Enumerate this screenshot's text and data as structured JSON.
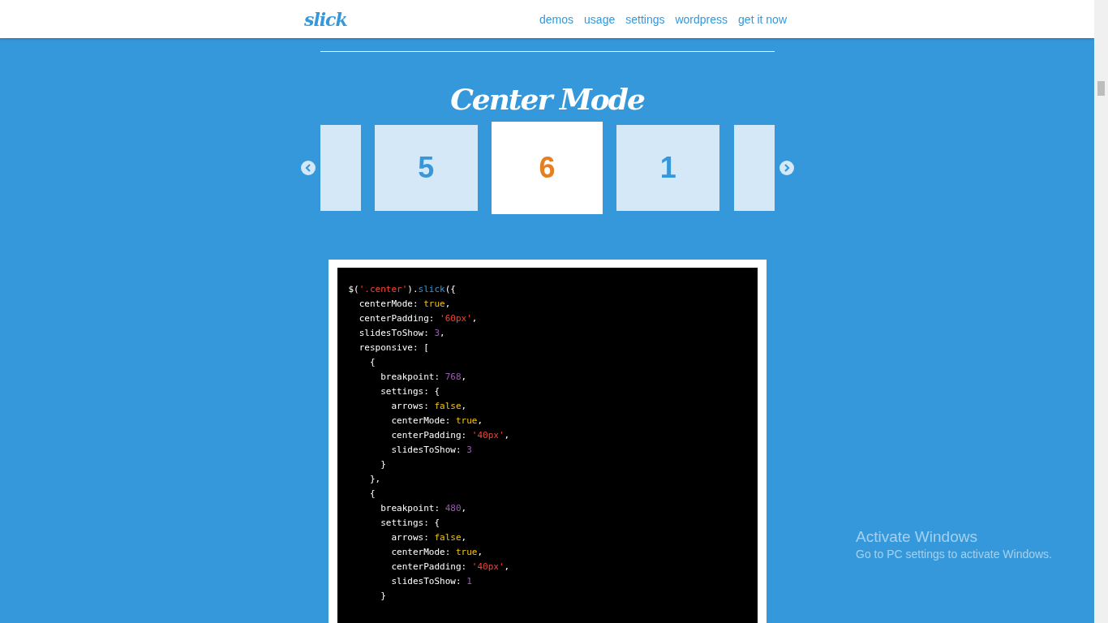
{
  "header": {
    "logo": "slick",
    "nav": [
      {
        "label": "demos"
      },
      {
        "label": "usage"
      },
      {
        "label": "settings"
      },
      {
        "label": "wordpress"
      },
      {
        "label": "get it now"
      }
    ]
  },
  "section": {
    "title": "Center Mode",
    "slides": [
      {
        "kind": "partial",
        "selected": false
      },
      {
        "kind": "slide",
        "label": "5",
        "selected": false
      },
      {
        "kind": "slide",
        "label": "6",
        "selected": true
      },
      {
        "kind": "slide",
        "label": "1",
        "selected": false
      },
      {
        "kind": "partial",
        "selected": false
      }
    ],
    "code": [
      [
        {
          "kind": "plain",
          "text": "$("
        },
        {
          "kind": "string",
          "text": "'.center'"
        },
        {
          "kind": "plain",
          "text": ")."
        },
        {
          "kind": "func",
          "text": "slick"
        },
        {
          "kind": "plain",
          "text": "({"
        }
      ],
      [
        {
          "kind": "plain",
          "text": "  centerMode: "
        },
        {
          "kind": "bool",
          "text": "true"
        },
        {
          "kind": "plain",
          "text": ","
        }
      ],
      [
        {
          "kind": "plain",
          "text": "  centerPadding: "
        },
        {
          "kind": "string",
          "text": "'60px'"
        },
        {
          "kind": "plain",
          "text": ","
        }
      ],
      [
        {
          "kind": "plain",
          "text": "  slidesToShow: "
        },
        {
          "kind": "number",
          "text": "3"
        },
        {
          "kind": "plain",
          "text": ","
        }
      ],
      [
        {
          "kind": "plain",
          "text": "  responsive: ["
        }
      ],
      [
        {
          "kind": "plain",
          "text": "    {"
        }
      ],
      [
        {
          "kind": "plain",
          "text": "      breakpoint: "
        },
        {
          "kind": "number",
          "text": "768"
        },
        {
          "kind": "plain",
          "text": ","
        }
      ],
      [
        {
          "kind": "plain",
          "text": "      settings: {"
        }
      ],
      [
        {
          "kind": "plain",
          "text": "        arrows: "
        },
        {
          "kind": "bool",
          "text": "false"
        },
        {
          "kind": "plain",
          "text": ","
        }
      ],
      [
        {
          "kind": "plain",
          "text": "        centerMode: "
        },
        {
          "kind": "bool",
          "text": "true"
        },
        {
          "kind": "plain",
          "text": ","
        }
      ],
      [
        {
          "kind": "plain",
          "text": "        centerPadding: "
        },
        {
          "kind": "string",
          "text": "'40px'"
        },
        {
          "kind": "plain",
          "text": ","
        }
      ],
      [
        {
          "kind": "plain",
          "text": "        slidesToShow: "
        },
        {
          "kind": "number",
          "text": "3"
        }
      ],
      [
        {
          "kind": "plain",
          "text": "      }"
        }
      ],
      [
        {
          "kind": "plain",
          "text": "    },"
        }
      ],
      [
        {
          "kind": "plain",
          "text": "    {"
        }
      ],
      [
        {
          "kind": "plain",
          "text": "      breakpoint: "
        },
        {
          "kind": "number",
          "text": "480"
        },
        {
          "kind": "plain",
          "text": ","
        }
      ],
      [
        {
          "kind": "plain",
          "text": "      settings: {"
        }
      ],
      [
        {
          "kind": "plain",
          "text": "        arrows: "
        },
        {
          "kind": "bool",
          "text": "false"
        },
        {
          "kind": "plain",
          "text": ","
        }
      ],
      [
        {
          "kind": "plain",
          "text": "        centerMode: "
        },
        {
          "kind": "bool",
          "text": "true"
        },
        {
          "kind": "plain",
          "text": ","
        }
      ],
      [
        {
          "kind": "plain",
          "text": "        centerPadding: "
        },
        {
          "kind": "string",
          "text": "'40px'"
        },
        {
          "kind": "plain",
          "text": ","
        }
      ],
      [
        {
          "kind": "plain",
          "text": "        slidesToShow: "
        },
        {
          "kind": "number",
          "text": "1"
        }
      ],
      [
        {
          "kind": "plain",
          "text": "      }"
        }
      ]
    ]
  },
  "os_overlay": {
    "title": "Activate Windows",
    "subtitle": "Go to PC settings to activate Windows."
  }
}
